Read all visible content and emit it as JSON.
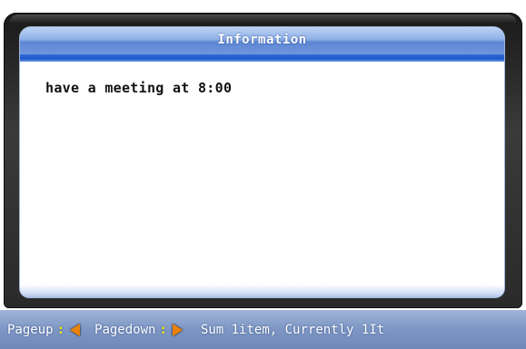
{
  "window": {
    "title": "Information"
  },
  "message": {
    "text": "have a meeting at 8:00"
  },
  "statusbar": {
    "pageup_label": "Pageup",
    "pagedown_label": "Pagedown",
    "separator": ":",
    "summary": "Sum 1item, Currently 1It",
    "icons": {
      "pageup": "left-arrow-icon",
      "pagedown": "right-arrow-icon"
    },
    "arrow_color": "#e8820a",
    "separator_color": "#f6f000"
  },
  "colors": {
    "title_bar": "#6f97de",
    "title_underline": "#1d57c9",
    "status_bar": "#7d96c4",
    "bezel": "#2a2a2a"
  }
}
